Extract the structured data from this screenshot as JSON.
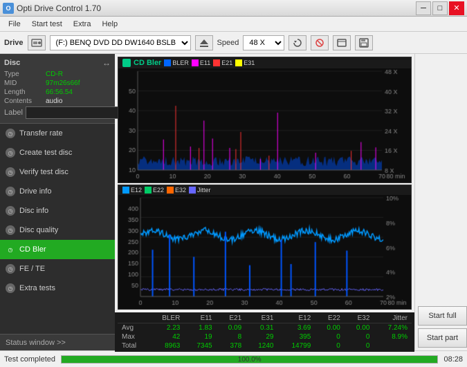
{
  "titleBar": {
    "title": "Opti Drive Control 1.70",
    "iconLabel": "O",
    "minimize": "─",
    "maximize": "□",
    "close": "✕"
  },
  "menu": {
    "items": [
      "File",
      "Start test",
      "Extra",
      "Help"
    ]
  },
  "drive": {
    "label": "Drive",
    "driveName": "(F:)  BENQ DVD DD DW1640 BSLB",
    "speedLabel": "Speed",
    "speedValue": "48 X"
  },
  "disc": {
    "title": "Disc",
    "type": {
      "label": "Type",
      "value": "CD-R"
    },
    "mid": {
      "label": "MID",
      "value": "97m26s66f"
    },
    "length": {
      "label": "Length",
      "value": "66:56.54"
    },
    "contents": {
      "label": "Contents",
      "value": "audio"
    },
    "labelLabel": "Label"
  },
  "sidebar": {
    "items": [
      {
        "id": "transfer-rate",
        "label": "Transfer rate",
        "active": false
      },
      {
        "id": "create-test-disc",
        "label": "Create test disc",
        "active": false
      },
      {
        "id": "verify-test-disc",
        "label": "Verify test disc",
        "active": false
      },
      {
        "id": "drive-info",
        "label": "Drive info",
        "active": false
      },
      {
        "id": "disc-info",
        "label": "Disc info",
        "active": false
      },
      {
        "id": "disc-quality",
        "label": "Disc quality",
        "active": false
      },
      {
        "id": "cd-bler",
        "label": "CD Bler",
        "active": true
      },
      {
        "id": "fe-te",
        "label": "FE / TE",
        "active": false
      },
      {
        "id": "extra-tests",
        "label": "Extra tests",
        "active": false
      }
    ],
    "statusWindow": "Status window >>"
  },
  "chart1": {
    "title": "CD Bler",
    "legend": [
      {
        "label": "BLER",
        "color": "#0066ff"
      },
      {
        "label": "E11",
        "color": "#ff00ff"
      },
      {
        "label": "E21",
        "color": "#ff3333"
      },
      {
        "label": "E31",
        "color": "#ffff00"
      }
    ],
    "yAxisRight": [
      "48 X",
      "40 X",
      "32 X",
      "24 X",
      "16 X",
      "8 X"
    ],
    "yAxisLeft": [
      50,
      40,
      30,
      20,
      10
    ],
    "xAxis": [
      0,
      10,
      20,
      30,
      40,
      50,
      60,
      70
    ],
    "xLabel": "80 min"
  },
  "chart2": {
    "legend": [
      {
        "label": "E12",
        "color": "#0099ff"
      },
      {
        "label": "E22",
        "color": "#00cc66"
      },
      {
        "label": "E32",
        "color": "#ff6600"
      },
      {
        "label": "Jitter",
        "color": "#6666ff"
      }
    ],
    "yAxisRight": [
      "10%",
      "8%",
      "6%",
      "4%",
      "2%"
    ],
    "yAxisLeft": [
      400,
      350,
      300,
      250,
      200,
      150,
      100,
      50
    ],
    "xAxis": [
      0,
      10,
      20,
      30,
      40,
      50,
      60,
      70
    ],
    "xLabel": "80 min"
  },
  "dataTable": {
    "headers": [
      "",
      "BLER",
      "E11",
      "E21",
      "E31",
      "E12",
      "E22",
      "E32",
      "Jitter"
    ],
    "rows": [
      {
        "label": "Avg",
        "values": [
          "2.23",
          "1.83",
          "0.09",
          "0.31",
          "3.69",
          "0.00",
          "0.00",
          "7.24%"
        ]
      },
      {
        "label": "Max",
        "values": [
          "42",
          "19",
          "8",
          "29",
          "395",
          "0",
          "0",
          "8.9%"
        ]
      },
      {
        "label": "Total",
        "values": [
          "8963",
          "7345",
          "378",
          "1240",
          "14799",
          "0",
          "0",
          ""
        ]
      }
    ]
  },
  "buttons": {
    "startFull": "Start full",
    "startPart": "Start part"
  },
  "statusBar": {
    "statusText": "Test completed",
    "progressPercent": 100,
    "progressLabel": "100.0%",
    "time": "08:28"
  }
}
